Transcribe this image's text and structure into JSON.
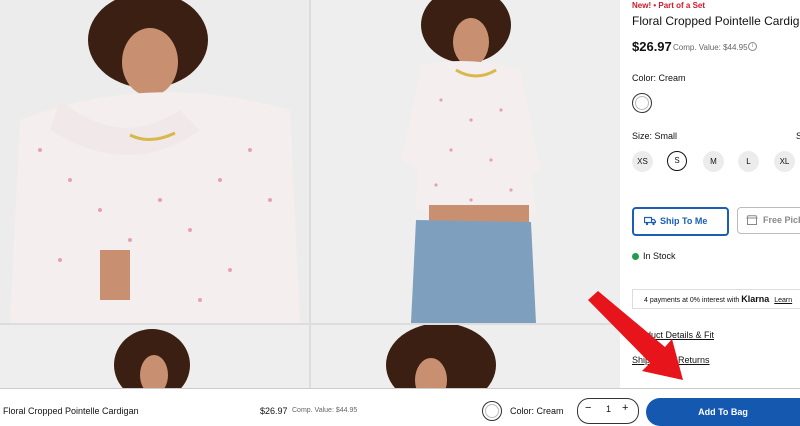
{
  "product": {
    "badge": "New! • Part of a Set",
    "title": "Floral Cropped Pointelle Cardigan",
    "price": "$26.97",
    "comp_value": "Comp. Value: $44.95",
    "info_icon": "info-icon",
    "color_label": "Color: Cream",
    "size_label": "Size: Small",
    "size_guide": "S",
    "sizes": [
      "XS",
      "S",
      "M",
      "L",
      "XL"
    ],
    "selected_size": "S",
    "ship_label": "Ship To Me",
    "pickup_label": "Free Pickup",
    "stock": "In Stock",
    "klarna": {
      "text": "4 payments at 0% interest with",
      "brand": "Klarna",
      "link": "Learn"
    },
    "details_link": "Product Details & Fit",
    "shipping_link": "Shipping & Returns"
  },
  "sticky_bar": {
    "name": "Floral Cropped Pointelle Cardigan",
    "price": "$26.97",
    "comp_value": "Comp. Value: $44.95",
    "color": "Color: Cream",
    "qty_minus": "−",
    "qty_value": "1",
    "qty_plus": "+",
    "add_label": "Add To Bag"
  },
  "colors": {
    "sale_red": "#d1182b",
    "accent_blue": "#1558b0",
    "stock_green": "#1e9e4a",
    "arrow_red": "#e8141b",
    "cardigan": "#f4eeee",
    "hair": "#3a1f12",
    "denim": "#7f9fbf"
  }
}
